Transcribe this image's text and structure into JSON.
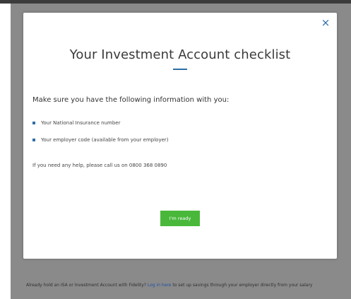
{
  "modal": {
    "close_symbol": "×",
    "title": "Your Investment Account checklist",
    "intro": "Make sure you have the following information with you:",
    "checklist": [
      "Your National Insurance number",
      "Your employer code (available from your employer)"
    ],
    "help_text": "If you need any help, please call us on 0800 368 0890",
    "ready_button": "I'm ready"
  },
  "footer": {
    "prefix": "Already hold an ISA or Investment Account with Fidelity?",
    "link": "Log in here",
    "suffix": "to set up savings through your employer directly from your salary"
  },
  "colors": {
    "accent_blue": "#2e6ea6",
    "button_green": "#49b83a",
    "overlay_gray": "#8a8a8a"
  }
}
